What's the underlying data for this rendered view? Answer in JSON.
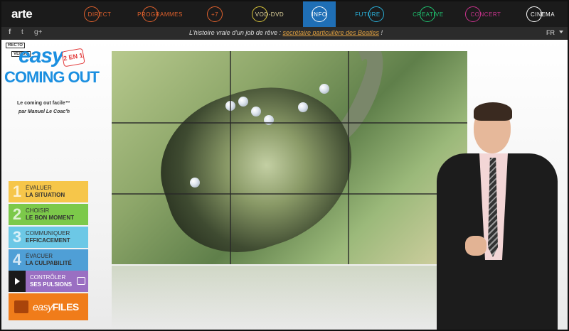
{
  "brand": {
    "logo": "arte"
  },
  "nav": {
    "items": [
      {
        "label": "DIRECT",
        "color": "#e0612d"
      },
      {
        "label": "PROGRAMMES",
        "color": "#e0612d"
      },
      {
        "label": "+7",
        "color": "#e0612d"
      },
      {
        "label": "VOD-DVD",
        "color": "#d8c43a"
      },
      {
        "label": "INFO",
        "color": "#ffffff",
        "active": true
      },
      {
        "label": "FUTURE",
        "color": "#2ab0d9"
      },
      {
        "label": "CREATIVE",
        "color": "#1fbf6e"
      },
      {
        "label": "CONCERT",
        "color": "#c9338d"
      },
      {
        "label": "CINEMA",
        "color": "#ffffff"
      }
    ],
    "active_color": "#1f6fb6"
  },
  "social": {
    "facebook": "f",
    "twitter": "t",
    "googleplus": "g+"
  },
  "tagline": {
    "before": "L'histoire vraie d'un job de rêve : ",
    "link": "secrétaire particulière des Beatles",
    "after": " !"
  },
  "language": "FR",
  "logo": {
    "badge_top": "RECTO",
    "badge_bottom": "VERSO",
    "easy": "easy",
    "coming_out": "COMING OUT",
    "two_in_one": "2 EN 1",
    "subtitle": "Le coming out facile™",
    "author": "par Manuel Le Coac'h"
  },
  "steps": [
    {
      "num": "1",
      "line1": "ÉVALUER",
      "line2": "LA SITUATION",
      "color": "#f6c64a"
    },
    {
      "num": "2",
      "line1": "CHOISIR",
      "line2": "LE BON MOMENT",
      "color": "#7cc94a"
    },
    {
      "num": "3",
      "line1": "COMMUNIQUER",
      "line2": "EFFICACEMENT",
      "color": "#6cc8e6"
    },
    {
      "num": "4",
      "line1": "ÉVACUER",
      "line2": "LA CULPABILITÉ",
      "color": "#4f9fd6"
    },
    {
      "num": "",
      "line1": "CONTRÔLER",
      "line2": "SES PULSIONS",
      "color": "#9a6fc2"
    }
  ],
  "easyfiles": {
    "easy": "easy",
    "files": "FILES"
  }
}
